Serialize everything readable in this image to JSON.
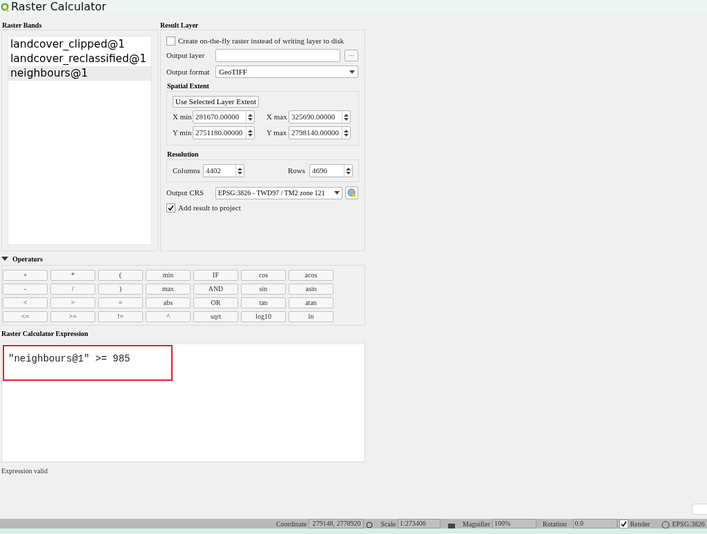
{
  "window": {
    "title": "Raster Calculator"
  },
  "raster_bands": {
    "title": "Raster Bands",
    "items": [
      {
        "label": "landcover_clipped@1",
        "selected": false
      },
      {
        "label": "landcover_reclassified@1",
        "selected": false
      },
      {
        "label": "neighbours@1",
        "selected": true
      }
    ]
  },
  "result_layer": {
    "title": "Result Layer",
    "on_the_fly": {
      "label": "Create on-the-fly raster instead of writing layer to disk",
      "checked": false
    },
    "output_layer": {
      "label": "Output layer",
      "browse": "···"
    },
    "output_format": {
      "label": "Output format",
      "value": "GeoTIFF"
    },
    "spatial_extent": {
      "title": "Spatial Extent",
      "button": "Use Selected Layer Extent",
      "fields": [
        {
          "label": "X min",
          "value": "281670.00000"
        },
        {
          "label": "X max",
          "value": "325690.00000"
        },
        {
          "label": "Y min",
          "value": "2751180.00000"
        },
        {
          "label": "Y max",
          "value": "2798140.00000"
        }
      ]
    },
    "resolution": {
      "title": "Resolution",
      "columns": {
        "label": "Columns",
        "value": "4402"
      },
      "rows": {
        "label": "Rows",
        "value": "4696"
      }
    },
    "output_crs": {
      "label": "Output CRS",
      "value": "EPSG:3826 - TWD97 / TM2 zone 121"
    },
    "add_to_project": {
      "label": "Add result to project",
      "checked": true
    }
  },
  "operators": {
    "title": "Operators",
    "expanded": true,
    "buttons": [
      "+",
      "*",
      "(",
      "min",
      "IF",
      "cos",
      "acos",
      "-",
      "/",
      ")",
      "max",
      "AND",
      "sin",
      "asin",
      "<",
      ">",
      "=",
      "abs",
      "OR",
      "tan",
      "atan",
      "<=",
      ">=",
      "!=",
      "^",
      "sqrt",
      "log10",
      "ln"
    ]
  },
  "expression": {
    "title": "Raster Calculator Expression",
    "value": "\"neighbours@1\" >= 985",
    "highlighted": true
  },
  "status": "Expression valid",
  "status_bar": {
    "coordinate_label": "Coordinate",
    "coordinate": "279148, 2778920",
    "scale_label": "Scale",
    "scale": "1:273406",
    "magnifier_label": "Magnifier",
    "magnifier": "100%",
    "rotation_label": "Rotation",
    "rotation": "0.0",
    "render": {
      "label": "Render",
      "checked": true
    },
    "crs": "EPSG:3826"
  }
}
